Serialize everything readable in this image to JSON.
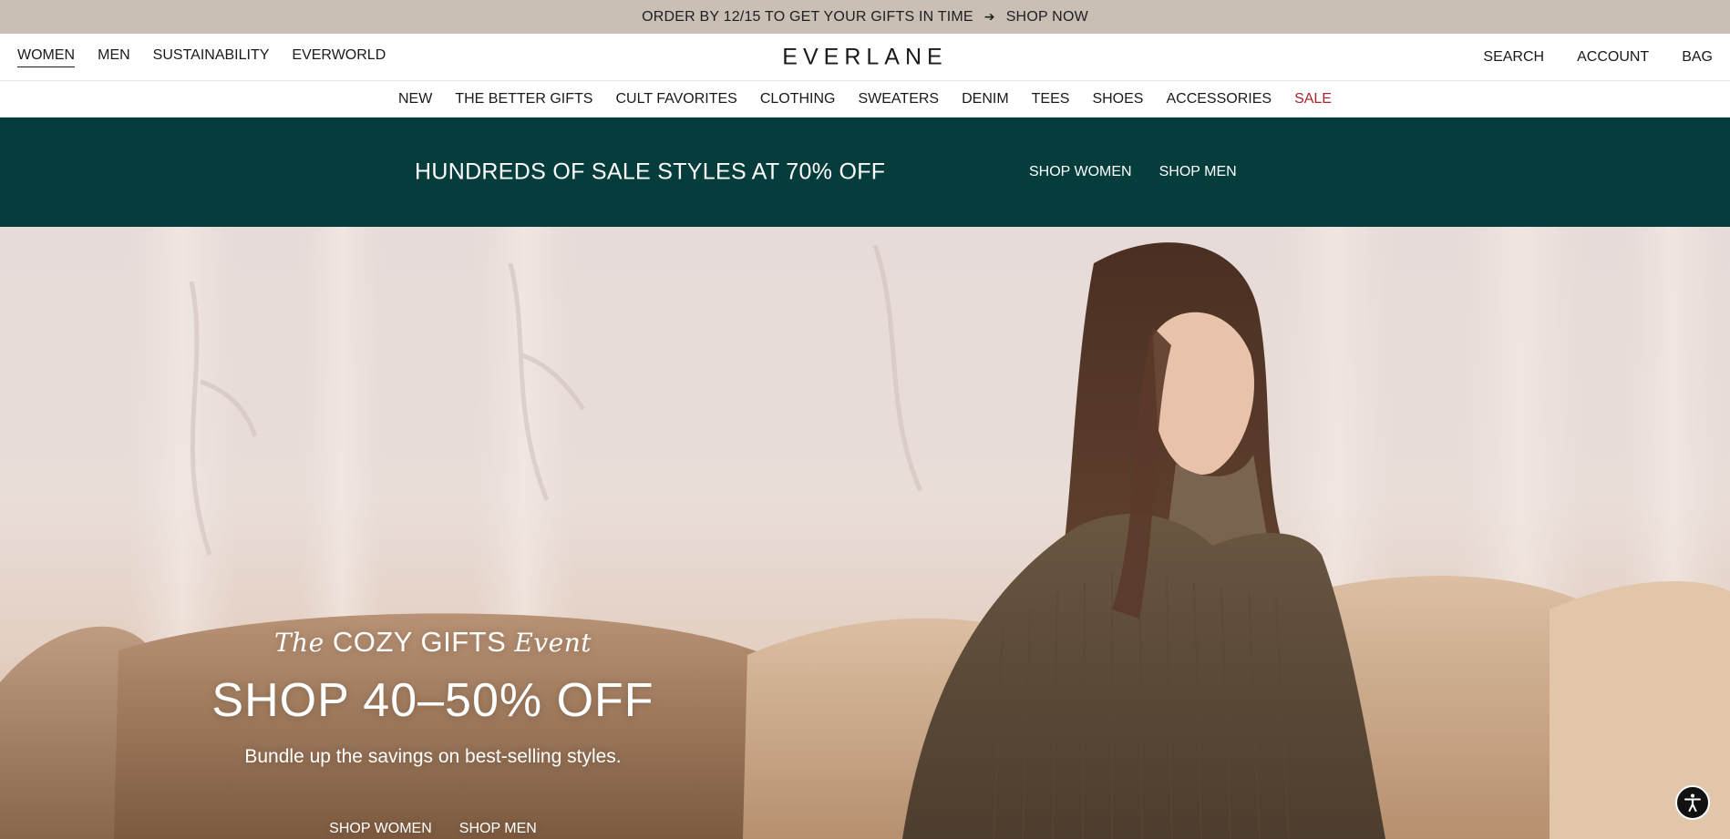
{
  "announcement": {
    "text": "ORDER BY 12/15 TO GET YOUR GIFTS IN TIME",
    "arrow": "➔",
    "link": "SHOP NOW"
  },
  "header": {
    "left_nav": [
      "WOMEN",
      "MEN",
      "SUSTAINABILITY",
      "EVERWORLD"
    ],
    "logo": "EVERLANE",
    "right_nav": [
      "SEARCH",
      "ACCOUNT",
      "BAG"
    ]
  },
  "categories": [
    "NEW",
    "THE BETTER GIFTS",
    "CULT FAVORITES",
    "CLOTHING",
    "SWEATERS",
    "DENIM",
    "TEES",
    "SHOES",
    "ACCESSORIES",
    "SALE"
  ],
  "sale_banner": {
    "headline": "HUNDREDS OF SALE STYLES AT 70% OFF",
    "links": [
      "SHOP WOMEN",
      "SHOP MEN"
    ],
    "background": "#043d3b"
  },
  "hero": {
    "eyebrow_prefix": "The",
    "eyebrow_main": "COZY GIFTS",
    "eyebrow_suffix": "Event",
    "headline": "SHOP 40–50% OFF",
    "subline": "Bundle up the savings on best-selling styles.",
    "ctas": [
      "SHOP WOMEN",
      "SHOP MEN"
    ]
  },
  "icons": {
    "accessibility": "accessibility-icon"
  },
  "colors": {
    "announcement_bg": "#c9bfb5",
    "sale_link": "#a8262b"
  }
}
